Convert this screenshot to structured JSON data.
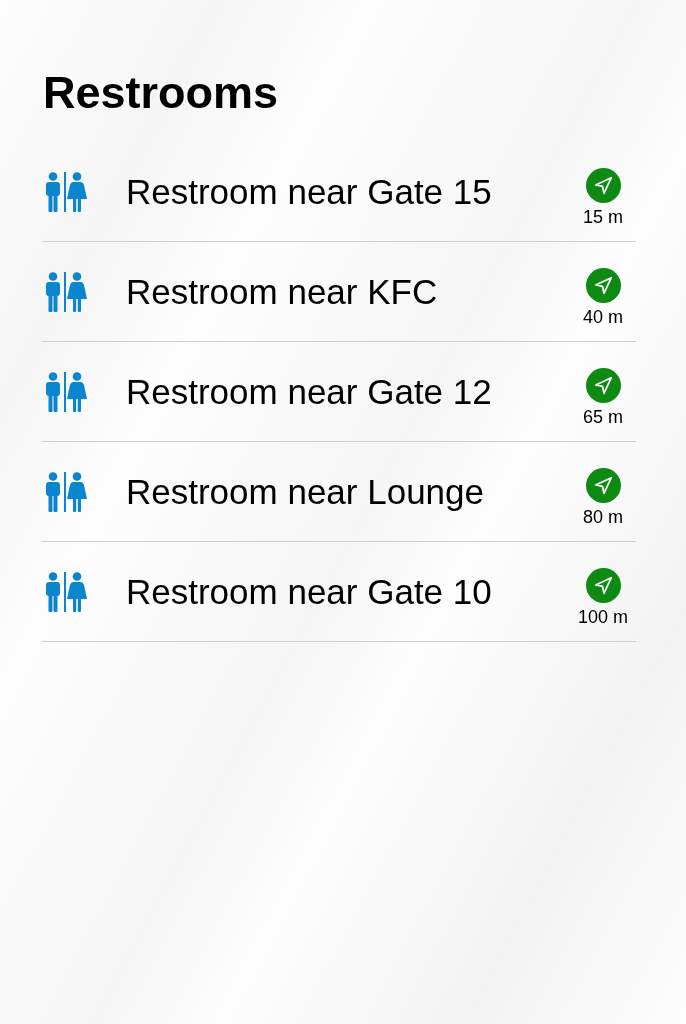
{
  "title": "Restrooms",
  "restrooms": [
    {
      "name": "Restroom near Gate 15",
      "distance": "15 m"
    },
    {
      "name": "Restroom near KFC",
      "distance": "40 m"
    },
    {
      "name": "Restroom near Gate 12",
      "distance": "65 m"
    },
    {
      "name": "Restroom near Lounge",
      "distance": "80 m"
    },
    {
      "name": "Restroom near Gate 10",
      "distance": "100 m"
    }
  ]
}
